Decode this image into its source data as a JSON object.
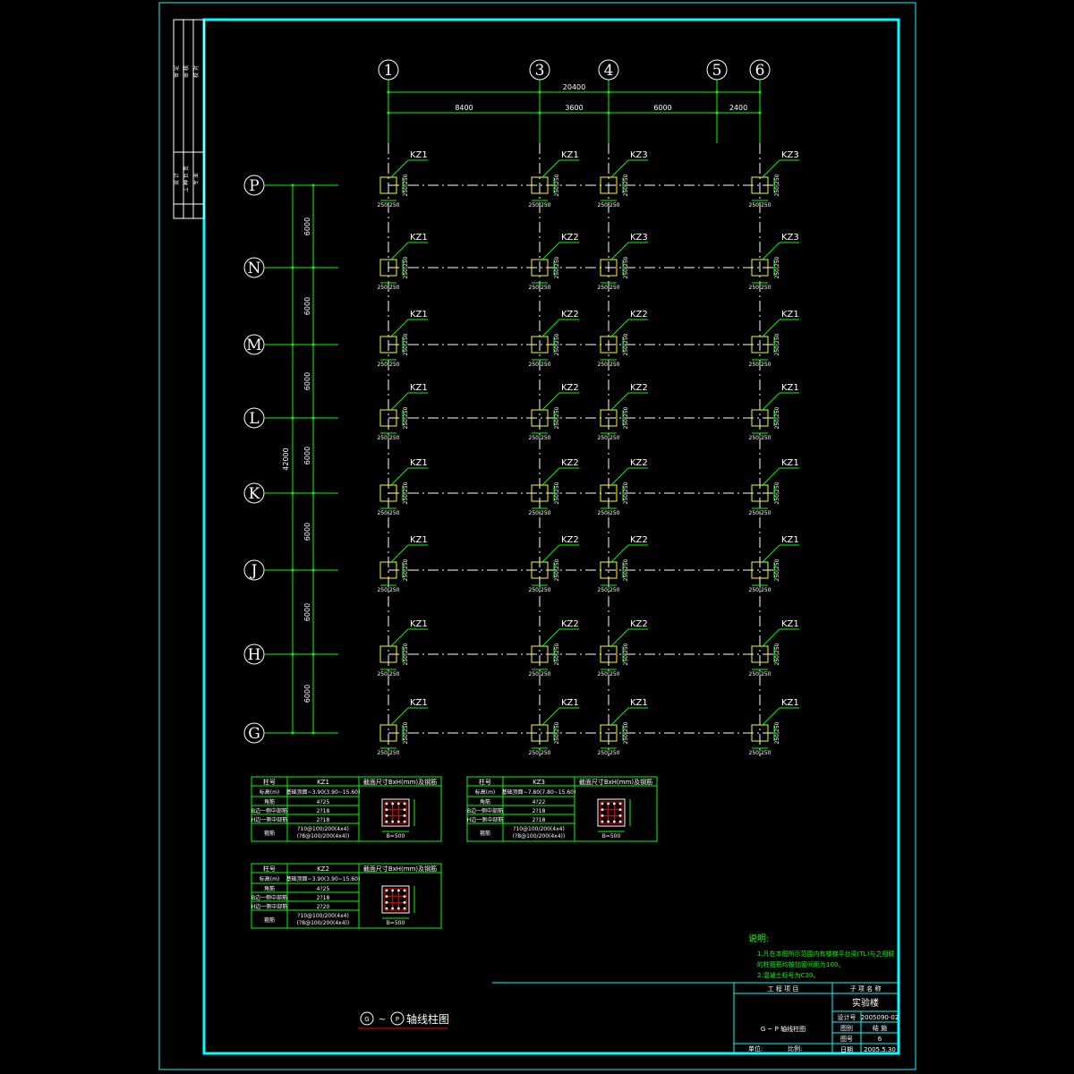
{
  "grid": {
    "columns": [
      {
        "label": "1",
        "key": "c1"
      },
      {
        "label": "3",
        "key": "c3"
      },
      {
        "label": "4",
        "key": "c4"
      },
      {
        "label": "5",
        "key": "c5"
      },
      {
        "label": "6",
        "key": "c6"
      }
    ],
    "rows": [
      {
        "label": "P"
      },
      {
        "label": "N"
      },
      {
        "label": "M"
      },
      {
        "label": "L"
      },
      {
        "label": "K"
      },
      {
        "label": "J"
      },
      {
        "label": "H"
      },
      {
        "label": "G"
      }
    ],
    "top_total": "20400",
    "top_dims": [
      "8400",
      "3600",
      "6000",
      "2400"
    ],
    "left_total": "42000",
    "left_dims": [
      "6000",
      "6000",
      "6000",
      "6000",
      "6000",
      "6000",
      "6000"
    ]
  },
  "column_labels": [
    [
      "KZ1",
      "KZ1",
      "KZ3",
      "KZ3"
    ],
    [
      "KZ1",
      "KZ2",
      "KZ3",
      "KZ3"
    ],
    [
      "KZ1",
      "KZ2",
      "KZ2",
      "KZ1"
    ],
    [
      "KZ1",
      "KZ2",
      "KZ2",
      "KZ1"
    ],
    [
      "KZ1",
      "KZ2",
      "KZ2",
      "KZ1"
    ],
    [
      "KZ1",
      "KZ2",
      "KZ2",
      "KZ1"
    ],
    [
      "KZ1",
      "KZ2",
      "KZ2",
      "KZ1"
    ],
    [
      "KZ1",
      "KZ1",
      "KZ1",
      "KZ1"
    ]
  ],
  "col_dim_text": "250|250",
  "tables": [
    {
      "name": "KZ1",
      "header": [
        "柱号",
        "KZ1",
        "截面尺寸BxH(mm)及钢筋"
      ],
      "rows": [
        [
          "标高(m)",
          "基础顶面~3.90(3.90~15.60)"
        ],
        [
          "角筋",
          "4?25"
        ],
        [
          "B边一侧中部筋",
          "2?18"
        ],
        [
          "H边一侧中部筋",
          "2?18"
        ],
        [
          "箍筋",
          "?10@100/200(4x4) (?8@100/200(4x4))"
        ]
      ],
      "dim": "B=500"
    },
    {
      "name": "KZ3",
      "header": [
        "柱号",
        "KZ3",
        "截面尺寸BxH(mm)及钢筋"
      ],
      "rows": [
        [
          "标高(m)",
          "基础顶面~7.80(7.80~15.60)"
        ],
        [
          "角筋",
          "4?22"
        ],
        [
          "B边一侧中部筋",
          "2?18"
        ],
        [
          "H边一侧中部筋",
          "2?18"
        ],
        [
          "箍筋",
          "?10@100/200(4x4) (?8@100/200(4x4))"
        ]
      ],
      "dim": "B=500"
    },
    {
      "name": "KZ2",
      "header": [
        "柱号",
        "KZ2",
        "截面尺寸BxH(mm)及钢筋"
      ],
      "rows": [
        [
          "标高(m)",
          "基础顶面~3.90(3.90~15.60)"
        ],
        [
          "角筋",
          "4?25"
        ],
        [
          "B边一侧中部筋",
          "2?18"
        ],
        [
          "H边一侧中部筋",
          "2?20"
        ],
        [
          "箍筋",
          "?10@100/200(4x4) (?8@100/200(4x4))"
        ]
      ],
      "dim": "B=500"
    }
  ],
  "notes": {
    "title": "说明:",
    "lines": [
      "1.凡在本图所示范围内有楼梯平台梁(TL)与之相联",
      "  的柱箍筋均按加密间距为100。",
      "2.混凝土标号为C30。"
    ]
  },
  "drawing_title": {
    "circ1": "G",
    "tilde": "~",
    "circ2": "P",
    "text": "轴线柱图"
  },
  "title_block": {
    "project_label": "工 程 项 目",
    "sub_label": "子 项 名 称",
    "sub_value": "实验楼",
    "drawing_name": "G ~ P 轴线柱图",
    "unit_label": "单位:",
    "scale_label": "比例:",
    "fields": [
      {
        "label": "设计号",
        "value": "2005090-02"
      },
      {
        "label": "图别",
        "value": "结 施"
      },
      {
        "label": "图号",
        "value": "6"
      },
      {
        "label": "日期",
        "value": "2005.5.30"
      }
    ]
  },
  "sign_block": {
    "cells": [
      "审 定",
      "审 核",
      "校 对",
      "设 计",
      "工 种 负 责",
      "专 业"
    ]
  },
  "colors": {
    "frame": "#00ffff",
    "lines": "#00ff00",
    "columns": "#ffff00",
    "axis": "#ffffff",
    "rebar": "#ff0000"
  }
}
